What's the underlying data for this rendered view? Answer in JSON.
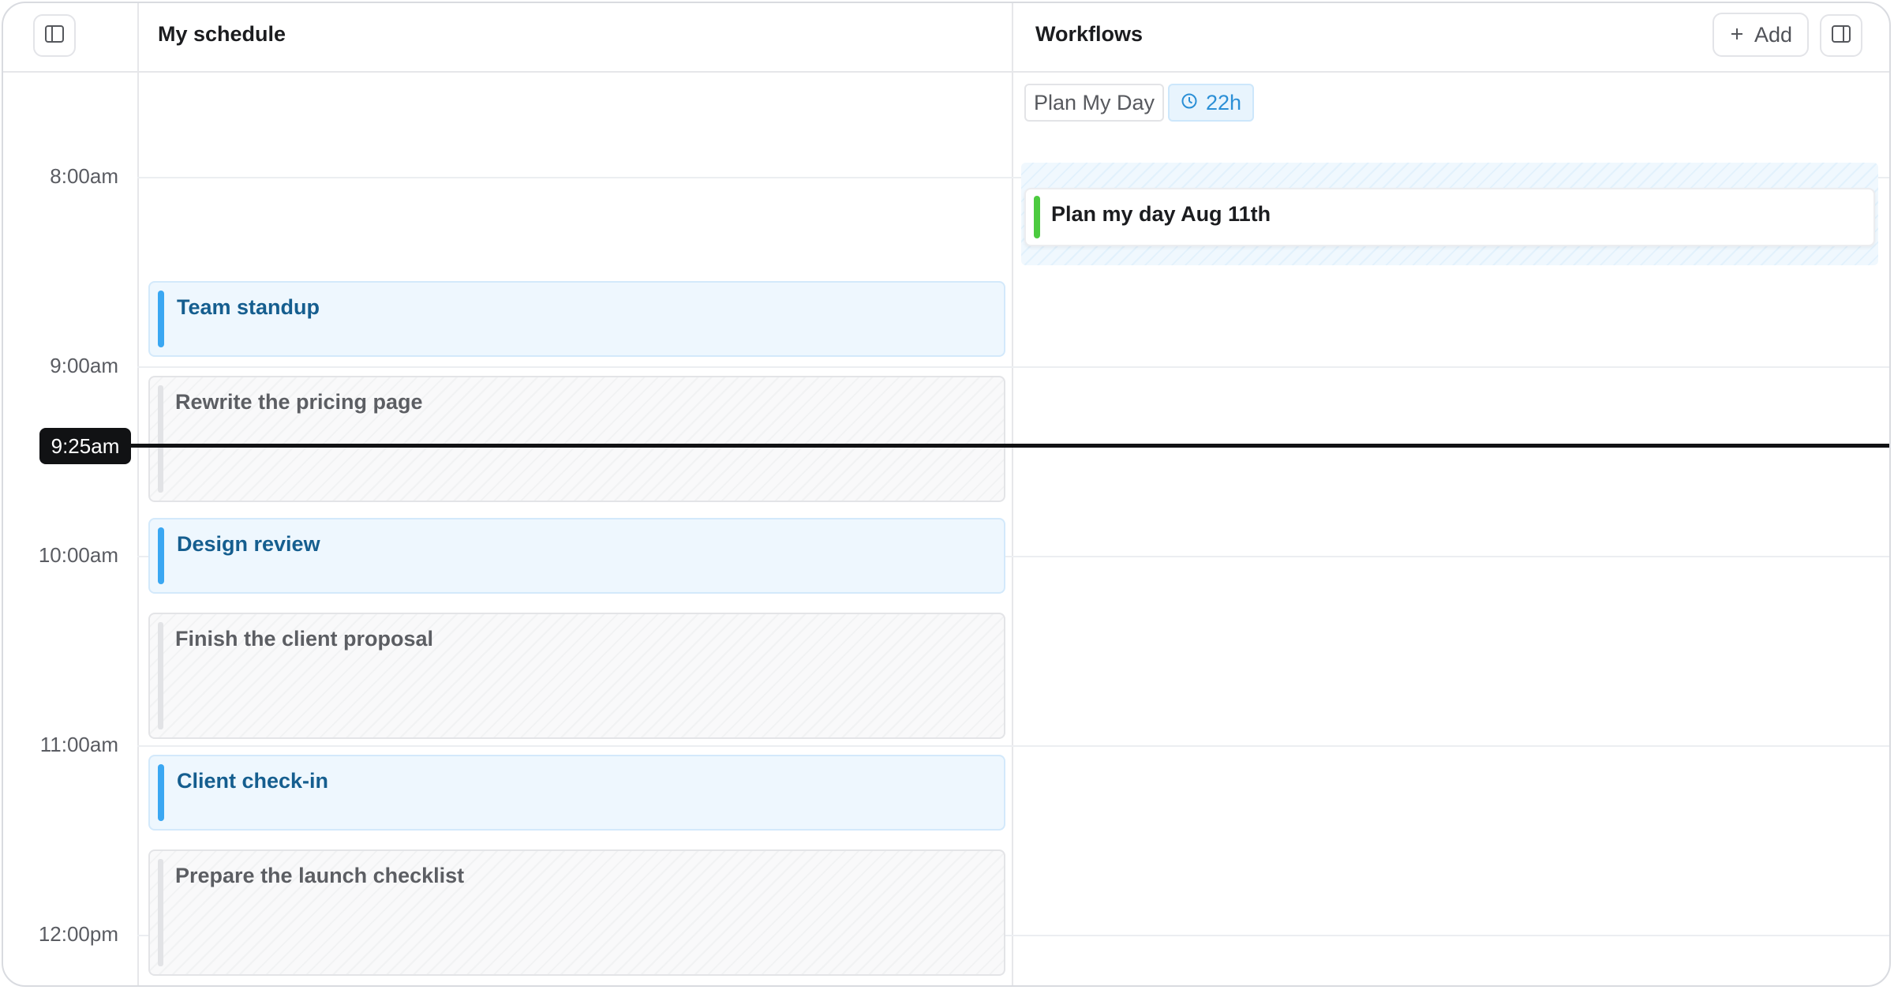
{
  "schedule_panel": {
    "title": "My schedule",
    "sidebar_toggle_icon": "sidebar-left-icon"
  },
  "workflows_panel": {
    "title": "Workflows",
    "add_label": "Add",
    "add_icon": "plus-icon",
    "panel_toggle_icon": "sidebar-right-icon"
  },
  "time_labels": [
    "8:00am",
    "9:00am",
    "10:00am",
    "11:00am",
    "12:00pm"
  ],
  "current_time": "9:25am",
  "events": [
    {
      "title": "Team standup",
      "kind": "meeting"
    },
    {
      "title": "Rewrite the pricing page",
      "kind": "task"
    },
    {
      "title": "Design review",
      "kind": "meeting"
    },
    {
      "title": "Finish the client proposal",
      "kind": "task"
    },
    {
      "title": "Client check-in",
      "kind": "meeting"
    },
    {
      "title": "Prepare the launch checklist",
      "kind": "task"
    }
  ],
  "workflow": {
    "name_chip": "Plan My Day",
    "duration_chip": "22h",
    "duration_icon": "clock-icon",
    "card_title": "Plan my day Aug 11th"
  },
  "colors": {
    "meeting_bar": "#3aa7f2",
    "meeting_text": "#155e8f",
    "workflow_bar": "#4ccb3f",
    "now_line": "#111214"
  }
}
